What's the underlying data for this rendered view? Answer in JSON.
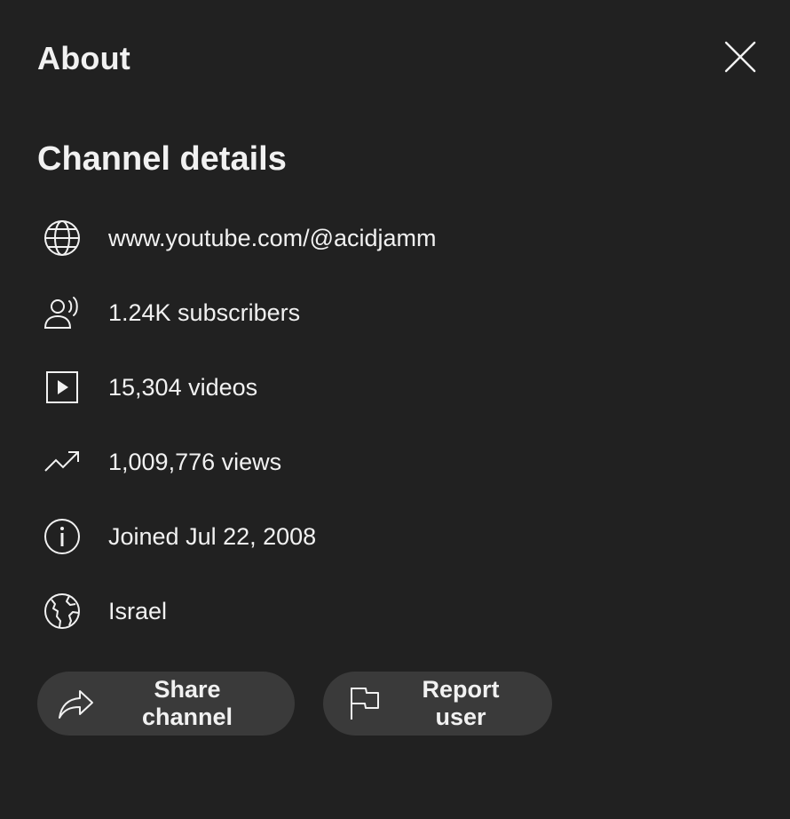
{
  "dialog": {
    "title": "About",
    "close_icon": "close-icon"
  },
  "channel_details": {
    "heading": "Channel details",
    "items": [
      {
        "icon": "globe-icon",
        "text": "www.youtube.com/@acidjamm"
      },
      {
        "icon": "subscribers-icon",
        "text": "1.24K subscribers"
      },
      {
        "icon": "play-video-icon",
        "text": "15,304 videos"
      },
      {
        "icon": "trending-up-icon",
        "text": "1,009,776 views"
      },
      {
        "icon": "info-icon",
        "text": "Joined Jul 22, 2008"
      },
      {
        "icon": "world-map-icon",
        "text": "Israel"
      }
    ]
  },
  "actions": {
    "share_label": "Share channel",
    "share_icon": "share-arrow-icon",
    "report_label": "Report user",
    "report_icon": "flag-icon"
  },
  "colors": {
    "background": "#212121",
    "text": "#f1f1f1",
    "button_background": "#3a3a3a"
  }
}
